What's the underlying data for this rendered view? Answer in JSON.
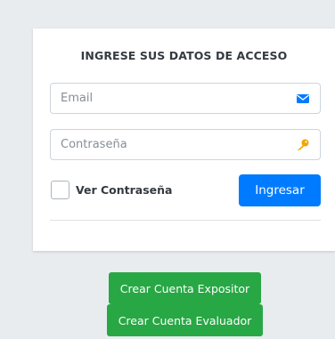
{
  "login_card": {
    "title": "INGRESE SUS DATOS DE ACCESO",
    "email_placeholder": "Email",
    "email_value": "",
    "email_icon": "envelope-icon",
    "password_placeholder": "Contraseña",
    "password_value": "",
    "password_icon": "key-icon",
    "show_password_label": "Ver Contraseña",
    "show_password_checked": false,
    "login_button_label": "Ingresar"
  },
  "actions": {
    "create_expositor_label": "Crear Cuenta Expositor",
    "create_evaluador_label": "Crear Cuenta Evaluador"
  },
  "colors": {
    "primary": "#007bff",
    "success": "#28a745",
    "background": "#e9ecef",
    "key_icon": "#f0a500"
  }
}
